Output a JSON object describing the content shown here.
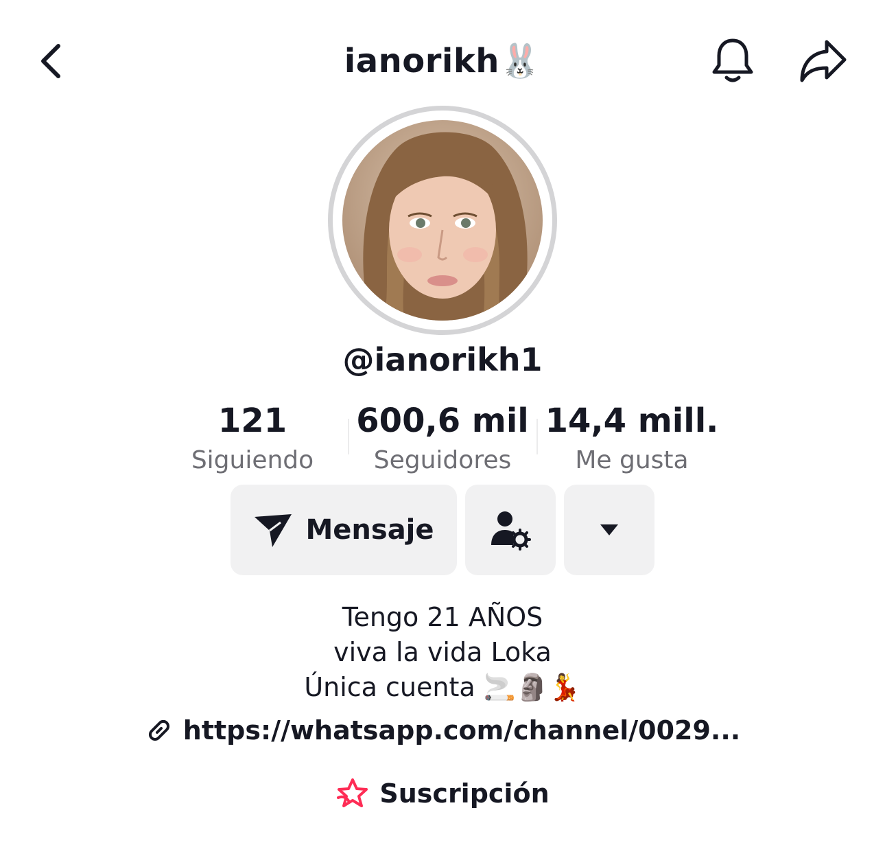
{
  "header": {
    "title": "ianorikh🐰"
  },
  "profile": {
    "handle": "@ianorikh1"
  },
  "stats": [
    {
      "value": "121",
      "label": "Siguiendo"
    },
    {
      "value": "600,6 mil",
      "label": "Seguidores"
    },
    {
      "value": "14,4 mill.",
      "label": "Me gusta"
    }
  ],
  "actions": {
    "message_label": "Mensaje"
  },
  "bio": {
    "lines": [
      "Tengo 21 AÑOS",
      "viva la vida Loka",
      "Única cuenta 🚬🗿💃"
    ]
  },
  "link": {
    "text": "https://whatsapp.com/channel/0029..."
  },
  "subscription": {
    "label": "Suscripción"
  },
  "colors": {
    "text": "#161823",
    "secondary_text": "#6e6e74",
    "button_bg": "#f1f1f2",
    "avatar_ring": "#d4d4d6",
    "subscription_accent": "#fe2c55"
  },
  "icons": [
    "back-chevron-icon",
    "bell-icon",
    "share-icon",
    "send-icon",
    "user-settings-icon",
    "caret-down-icon",
    "link-icon",
    "star-icon"
  ]
}
